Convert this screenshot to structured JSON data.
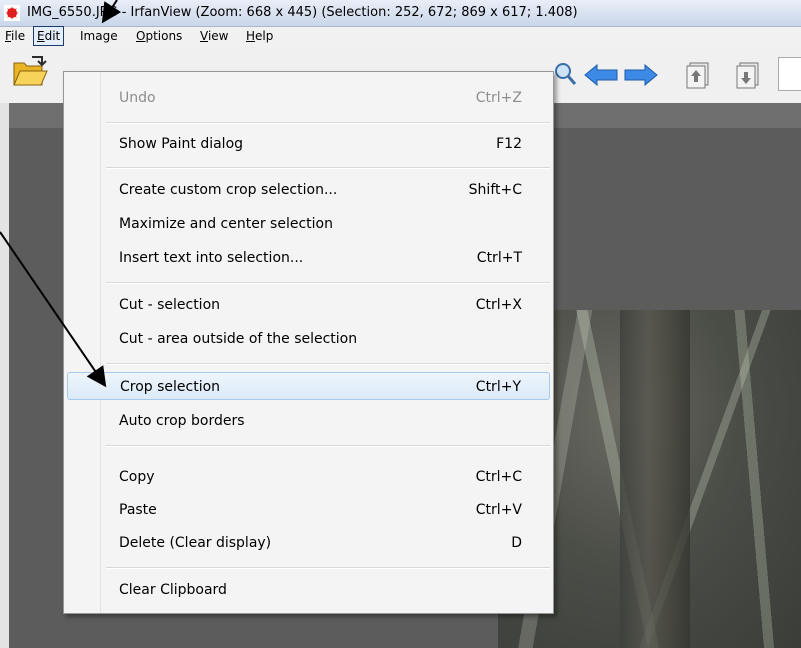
{
  "window": {
    "title": "IMG_6550.JPG - IrfanView (Zoom: 668 x 445) (Selection: 252, 672; 869 x 617; 1.408)"
  },
  "menubar": {
    "items": [
      {
        "accel": "F",
        "rest": "ile"
      },
      {
        "accel": "E",
        "rest": "dit"
      },
      {
        "accel": "",
        "rest": "Image"
      },
      {
        "accel": "O",
        "rest": "ptions"
      },
      {
        "accel": "V",
        "rest": "iew"
      },
      {
        "accel": "H",
        "rest": "elp"
      }
    ]
  },
  "toolbar": {
    "icons": [
      "open-folder-icon",
      "zoom-icon",
      "arrow-left-icon",
      "arrow-right-icon",
      "page-up-icon",
      "page-down-icon"
    ]
  },
  "edit_menu": {
    "items": [
      {
        "label": "Undo",
        "shortcut": "Ctrl+Z",
        "disabled": true
      },
      {
        "label": "Show Paint dialog",
        "shortcut": "F12"
      },
      {
        "label": "Create custom crop selection...",
        "shortcut": "Shift+C"
      },
      {
        "label": "Maximize and center selection",
        "shortcut": ""
      },
      {
        "label": "Insert text into selection...",
        "shortcut": "Ctrl+T"
      },
      {
        "label": "Cut - selection",
        "shortcut": "Ctrl+X"
      },
      {
        "label": "Cut - area outside of the selection",
        "shortcut": ""
      },
      {
        "label": "Crop selection",
        "shortcut": "Ctrl+Y",
        "highlighted": true
      },
      {
        "label": "Auto crop borders",
        "shortcut": ""
      },
      {
        "label": "Copy",
        "shortcut": "Ctrl+C"
      },
      {
        "label": "Paste",
        "shortcut": "Ctrl+V"
      },
      {
        "label": "Delete (Clear display)",
        "shortcut": "D"
      },
      {
        "label": "Clear Clipboard",
        "shortcut": ""
      }
    ]
  },
  "colors": {
    "highlight_border": "#a8c8eb",
    "arrow_stroke": "#000000",
    "toolbar_arrow_blue": "#2f7fe0"
  }
}
